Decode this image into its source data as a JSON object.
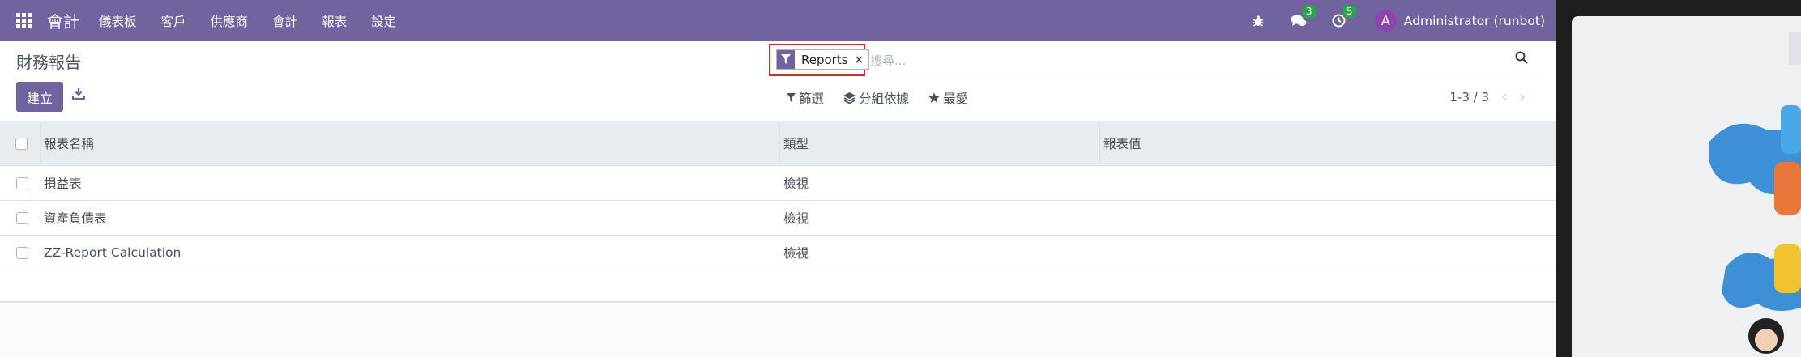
{
  "navbar": {
    "brand": "會計",
    "menu": [
      "儀表板",
      "客戶",
      "供應商",
      "會計",
      "報表",
      "設定"
    ],
    "messages_count": "3",
    "activities_count": "5",
    "avatar_letter": "A",
    "user": "Administrator (runbot)"
  },
  "page": {
    "title": "財務報告"
  },
  "search": {
    "facet_value": "Reports",
    "facet_remove": "×",
    "placeholder": "搜尋..."
  },
  "actions": {
    "create": "建立"
  },
  "tools": {
    "filter": "篩選",
    "group_by": "分組依據",
    "favorites": "最愛"
  },
  "pager": {
    "value": "1-3 / 3"
  },
  "table": {
    "headers": [
      "報表名稱",
      "類型",
      "報表值"
    ],
    "rows": [
      {
        "name": "損益表",
        "type": "檢視",
        "value": ""
      },
      {
        "name": "資產負債表",
        "type": "檢視",
        "value": ""
      },
      {
        "name": "ZZ-Report Calculation",
        "type": "檢視",
        "value": ""
      }
    ]
  },
  "colors": {
    "brand": "#71639e",
    "badge": "#28a745",
    "highlight": "#c0312f"
  },
  "icons": [
    "apps-icon",
    "bug-icon",
    "chat-icon",
    "clock-icon",
    "filter-icon",
    "download-icon",
    "search-icon",
    "layers-icon",
    "star-icon",
    "chevron-left-icon",
    "chevron-right-icon"
  ]
}
